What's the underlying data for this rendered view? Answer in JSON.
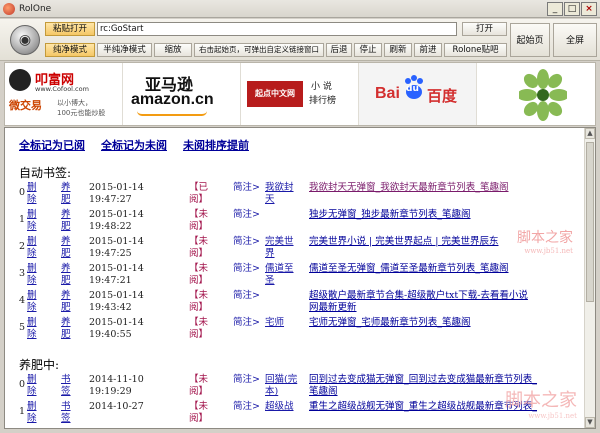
{
  "window": {
    "title": "RolOne",
    "min": "_",
    "max": "□",
    "close": "×"
  },
  "toolbar": {
    "paste_open": "粘贴打开",
    "address": "rc:GoStart",
    "open": "打开",
    "pure_mode": "纯净模式",
    "semi_pure_mode": "半纯净模式",
    "thumbnail": "缩放",
    "hint": "右击起始页，可弹出自定义链接窗口",
    "back": "后退",
    "stop": "停止",
    "refresh": "刷新",
    "forward": "前进",
    "rolone_forum": "Rolone贴吧",
    "start_page": "起始页",
    "fullscreen": "全屏"
  },
  "banner": {
    "cofool_logo": "叩富网",
    "cofool_sub": "微交易",
    "cofool_url": "www.Cofool.com",
    "cofool_slogan1": "以小博大，",
    "cofool_slogan2": "100元也能炒股",
    "amazon_cn": "亚马逊",
    "amazon_en": "amazon.cn",
    "qidian_tag": "起点中文网",
    "qidian_label1": "小 说",
    "qidian_label2": "排行榜",
    "baidu_en": "Bai",
    "baidu_paw": "du",
    "baidu_cn": "百度"
  },
  "content": {
    "mark_all_read": "全标记为已阅",
    "mark_all_unread": "全标记为未阅",
    "unread_first": "未阅排序提前",
    "auto_bookmarks": "自动书签:",
    "yangfei": "养肥中:",
    "auto_rows": [
      {
        "idx": "0",
        "del": "删",
        "del2": "除",
        "act": "养",
        "act2": "肥",
        "date": "2015-01-14",
        "time": "19:47:27",
        "status": "【已",
        "status2": "阅】",
        "note": "简注>",
        "novel": "我欲封",
        "novel2": "天",
        "title": "我欲封天无弹窗_我欲封天最新章节列表_笔趣阁",
        "visited": true
      },
      {
        "idx": "1",
        "del": "删",
        "del2": "除",
        "act": "养",
        "act2": "肥",
        "date": "2015-01-14",
        "time": "19:48:22",
        "status": "【未",
        "status2": "阅】",
        "note": "简注>",
        "novel": "",
        "novel2": "",
        "title": "独步无弹窗_独步最新章节列表_笔趣阁",
        "visited": false
      },
      {
        "idx": "2",
        "del": "删",
        "del2": "除",
        "act": "养",
        "act2": "肥",
        "date": "2015-01-14",
        "time": "19:47:25",
        "status": "【未",
        "status2": "阅】",
        "note": "简注>",
        "novel": "完美世",
        "novel2": "界",
        "title": "完美世界小说 | 完美世界起点 | 完美世界辰东",
        "visited": false
      },
      {
        "idx": "3",
        "del": "删",
        "del2": "除",
        "act": "养",
        "act2": "肥",
        "date": "2015-01-14",
        "time": "19:47:21",
        "status": "【未",
        "status2": "阅】",
        "note": "简注>",
        "novel": "儒道至",
        "novel2": "圣",
        "title": "儒道至圣无弹窗_儒道至圣最新章节列表_笔趣阁",
        "visited": false
      },
      {
        "idx": "4",
        "del": "删",
        "del2": "除",
        "act": "养",
        "act2": "肥",
        "date": "2015-01-14",
        "time": "19:43:42",
        "status": "【未",
        "status2": "阅】",
        "note": "简注>",
        "novel": "",
        "novel2": "",
        "title": "超级散户最新章节合集-超级散户txt下载-去看看小说",
        "title2": "网最新更新",
        "visited": false
      },
      {
        "idx": "5",
        "del": "删",
        "del2": "除",
        "act": "养",
        "act2": "肥",
        "date": "2015-01-14",
        "time": "19:40:55",
        "status": "【未",
        "status2": "阅】",
        "note": "简注>",
        "novel": "宅师",
        "novel2": "",
        "title": "宅师无弹窗_宅师最新章节列表_笔趣阁",
        "visited": false
      }
    ],
    "yf_rows": [
      {
        "idx": "0",
        "del": "删",
        "del2": "除",
        "act": "书",
        "act2": "签",
        "date": "2014-11-10",
        "time": "19:19:29",
        "status": "【未",
        "status2": "阅】",
        "note": "简注>",
        "novel": "回猫(完",
        "novel2": "本)",
        "title": "回到过去变成猫无弹窗_回到过去变成猫最新章节列表_",
        "title2": "笔趣阁"
      },
      {
        "idx": "1",
        "del": "删",
        "del2": "除",
        "act": "书",
        "act2": "签",
        "date": "2014-10-27",
        "time": "",
        "status": "【未",
        "status2": "阅】",
        "note": "简注>",
        "novel": "超级战",
        "novel2": "",
        "title": "重生之超级战舰无弹窗_重生之超级战舰最新章节列表_",
        "title2": ""
      }
    ],
    "watermark_top": "脚本之家",
    "watermark_top_url": "www.jb51.net",
    "watermark_bottom": "脚本之家",
    "watermark_bottom_url": "www.jb51.net"
  }
}
